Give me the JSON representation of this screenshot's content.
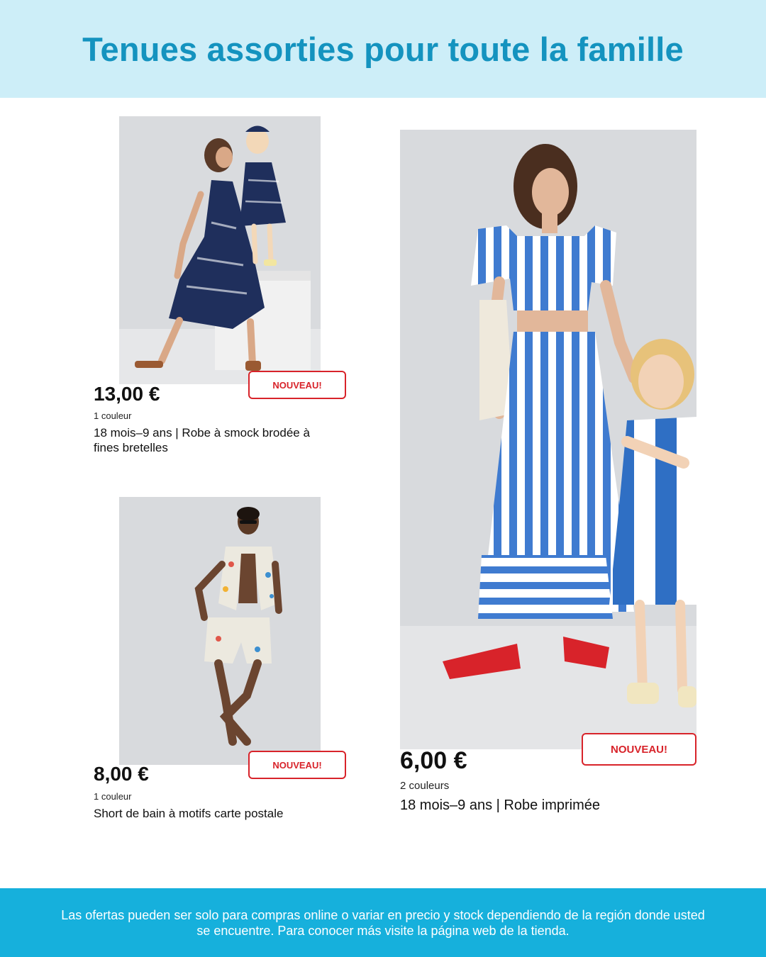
{
  "header": {
    "title": "Tenues assorties pour toute la famille"
  },
  "products": [
    {
      "price": "13,00 €",
      "colors": "1 couleur",
      "title": "18 mois–9 ans | Robe à smock brodée à fines bretelles",
      "badge": "NOUVEAU!"
    },
    {
      "price": "8,00 €",
      "colors": "1 couleur",
      "title": "Short de bain à motifs carte postale",
      "badge": "NOUVEAU!"
    },
    {
      "price": "6,00 €",
      "colors": "2 couleurs",
      "title": "18 mois–9 ans | Robe imprimée",
      "badge": "NOUVEAU!"
    }
  ],
  "footer": {
    "disclaimer": "Las ofertas pueden ser solo para compras online o variar en precio y stock dependiendo de la región donde usted se encuentre. Para conocer más visite la página web de la tienda."
  },
  "colors": {
    "header_bg": "#cdeef8",
    "header_text": "#1493bf",
    "badge_red": "#d8232a",
    "footer_bg": "#16b0dc"
  }
}
